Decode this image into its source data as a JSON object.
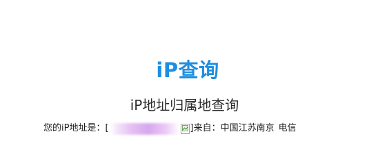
{
  "logo": {
    "text": "iP查询",
    "color": "#1e8fe0"
  },
  "heading": "iP地址归属地查询",
  "ip_info": {
    "ip_label": "您的iP地址是：",
    "bracket_open": "[",
    "bracket_close": "]",
    "location_label": " 来自：",
    "location": "中国江苏南京",
    "isp": "电信"
  }
}
